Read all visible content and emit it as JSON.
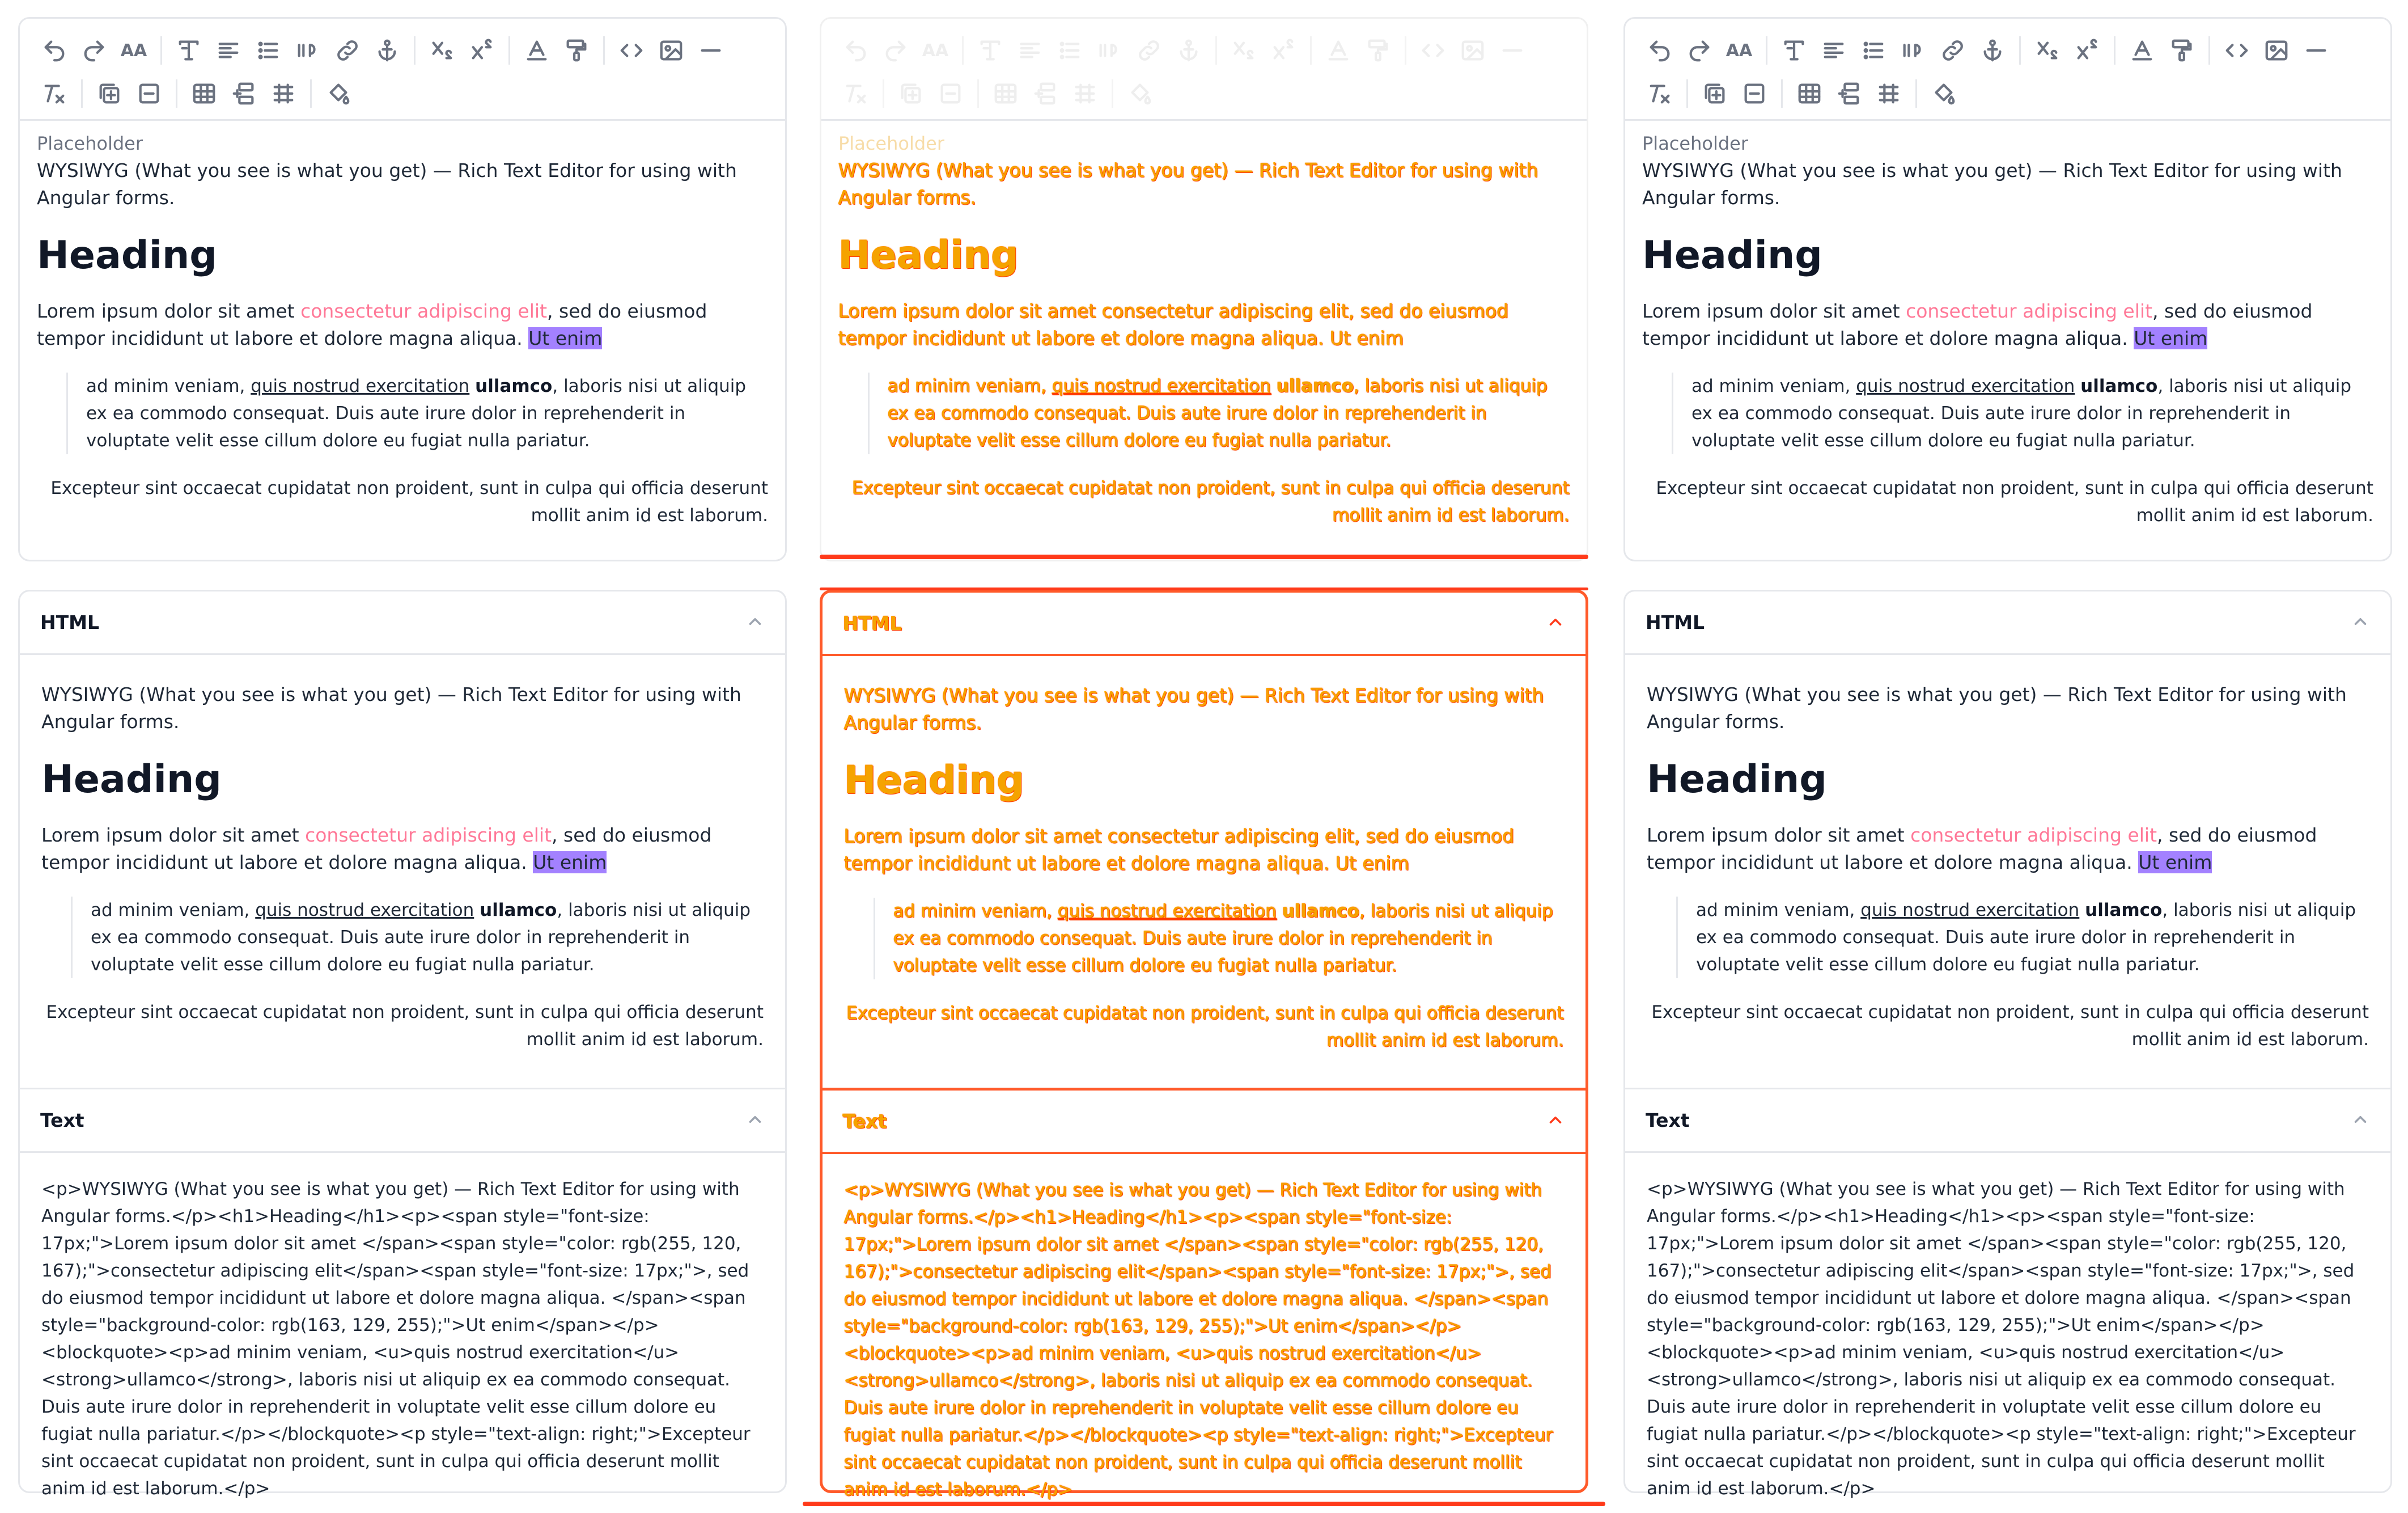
{
  "toolbar": {
    "row1": [
      "undo-icon",
      "redo-icon",
      "font-size-icon",
      "|",
      "text-style-icon",
      "align-icon",
      "bulleted-list-icon",
      "blockquote-icon",
      "link-icon",
      "anchor-icon",
      "|",
      "subscript-icon",
      "superscript-icon",
      "|",
      "text-color-icon",
      "format-painter-icon",
      "|",
      "code-icon",
      "image-icon",
      "horizontal-rule-icon"
    ],
    "row2": [
      "clear-format-icon",
      "|",
      "add-block-icon",
      "remove-block-icon",
      "|",
      "table-icon",
      "insert-row-icon",
      "grid-icon",
      "|",
      "fill-color-icon"
    ]
  },
  "editor": {
    "placeholder": "Placeholder",
    "intro": "WYSIWYG (What you see is what you get) — Rich Text Editor for using with Angular forms.",
    "heading": "Heading",
    "para_start": "Lorem ipsum dolor sit amet ",
    "para_pink": "consectetur adipiscing elit",
    "para_mid": ", sed do eiusmod tempor incididunt ut labore et dolore magna aliqua. ",
    "para_highlight": "Ut enim",
    "quote_start": "ad minim veniam, ",
    "quote_underline": "quis nostrud exercitation",
    "quote_bold": "ullamco",
    "quote_end": ", laboris nisi ut aliquip ex ea commodo consequat. Duis aute irure dolor in reprehenderit in voluptate velit esse cillum dolore eu fugiat nulla pariatur.",
    "right_para": "Excepteur sint occaecat cupidatat non proident, sunt in culpa qui officia deserunt mollit anim id est laborum."
  },
  "panels": {
    "html_title": "HTML",
    "text_title": "Text",
    "source": "<p>WYSIWYG (What you see is what you get) — Rich Text Editor for using with Angular forms.</p><h1>Heading</h1><p><span style=\"font-size: 17px;\">Lorem ipsum dolor sit amet </span><span style=\"color: rgb(255, 120, 167);\">consectetur adipiscing elit</span><span style=\"font-size: 17px;\">, sed do eiusmod tempor incididunt ut labore et dolore magna aliqua. </span><span style=\"background-color: rgb(163, 129, 255);\">Ut enim</span></p><blockquote><p>ad minim veniam, <u>quis nostrud exercitation</u> <strong>ullamco</strong>, laboris nisi ut aliquip ex ea commodo consequat. Duis aute irure dolor in reprehenderit in voluptate velit esse cillum dolore eu fugiat nulla pariatur.</p></blockquote><p style=\"text-align: right;\">Excepteur sint occaecat cupidatat non proident, sunt in culpa qui officia deserunt mollit anim id est laborum.</p>"
  },
  "colors": {
    "pink": "#ff7897",
    "highlight": "#a381ff",
    "diff_orange": "#f5a300",
    "diff_red": "#ff3a1a"
  }
}
